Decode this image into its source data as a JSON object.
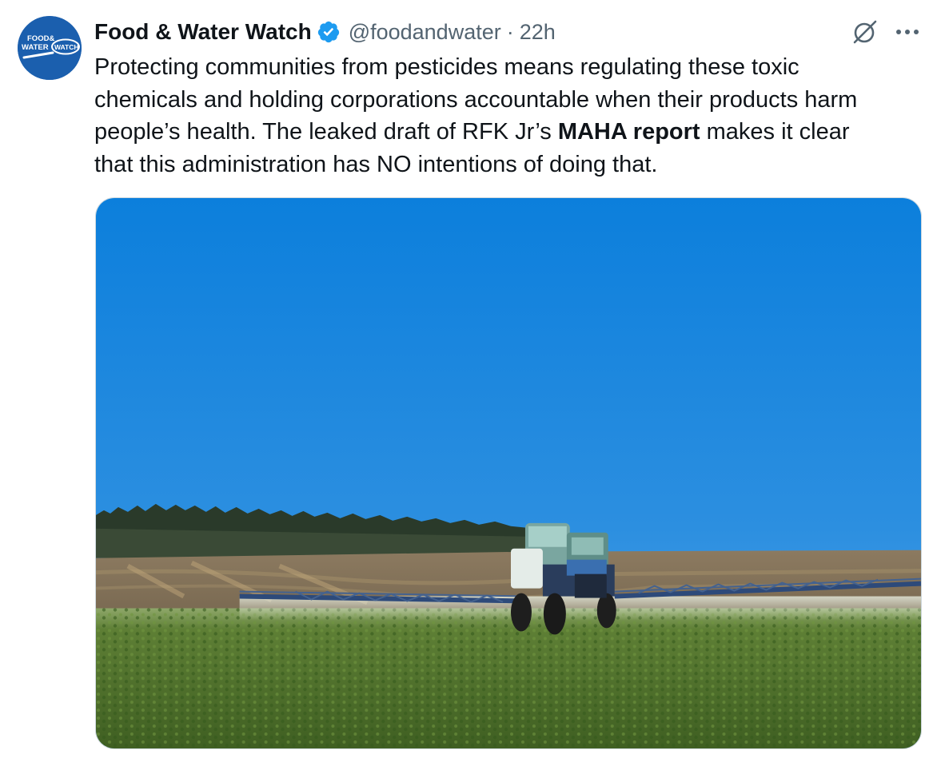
{
  "author": {
    "name": "Food & Water Watch",
    "handle": "@foodandwater",
    "separator": "·",
    "time": "22h",
    "avatar_text": [
      "FOOD&",
      "WATER",
      "WATCH"
    ],
    "verified": true
  },
  "tweet": {
    "text_lines": [
      "Protecting communities from pesticides means regulating these toxic",
      "chemicals and holding corporations accountable when their products harm",
      "people’s health. The leaked draft of RFK Jr’s "
    ],
    "bold_phrase": "MAHA report",
    "text_after_bold": " makes it clear",
    "text_last_line": "that this administration has NO intentions of doing that."
  },
  "icons": {
    "verified": "verified-badge-icon",
    "grok": "grok-icon",
    "more": "more-options-icon"
  },
  "colors": {
    "text": "#0f1419",
    "secondary": "#536471",
    "verified": "#1d9bf0",
    "avatar_bg": "#1b5fae"
  }
}
